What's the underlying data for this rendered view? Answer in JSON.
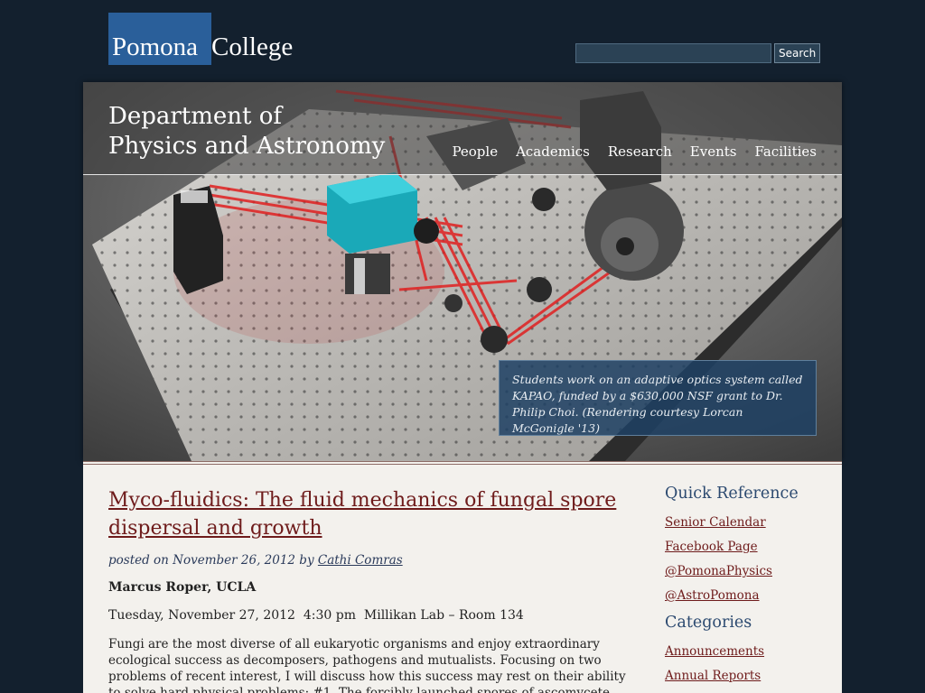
{
  "header": {
    "logo_part1": "Pomona",
    "logo_part2": "College",
    "search_value": "",
    "search_button": "Search"
  },
  "hero": {
    "title_line1": "Department of",
    "title_line2": "Physics and Astronomy",
    "nav": [
      "People",
      "Academics",
      "Research",
      "Events",
      "Facilities"
    ],
    "caption": "Students work on an adaptive optics system called KAPAO, funded by a $630,000 NSF grant to Dr. Philip Choi. (Rendering courtesy Lorcan McGonigle '13)"
  },
  "post": {
    "title": "Myco-fluidics: The fluid mechanics of fungal spore dispersal and growth",
    "meta_prefix": "posted on November 26, 2012 by",
    "author": "Cathi Comras",
    "speaker": "Marcus Roper, UCLA",
    "event_line": "Tuesday, November 27, 2012  4:30 pm  Millikan Lab – Room 134",
    "abstract": "Fungi are the most diverse of all eukaryotic organisms and enjoy extraordinary ecological success as decomposers, pathogens and mutualists. Focusing on two problems of recent interest, I will discuss how this success may rest on their ability to solve hard physical problems: #1. The forcibly launched spores of ascomycete fungi must eject through a boundary layer of"
  },
  "sidebar": {
    "quick_heading": "Quick Reference",
    "quick_links": [
      "Senior Calendar",
      "Facebook Page",
      "@PomonaPhysics",
      "@AstroPomona"
    ],
    "categories_heading": "Categories",
    "category_links": [
      "Announcements",
      "Annual Reports"
    ]
  },
  "colors": {
    "page_bg": "#13202e",
    "logo_blue": "#2a5f9a",
    "link": "#6e1b1b",
    "heading": "#2c4a70",
    "content_bg": "#f3f1ed"
  }
}
